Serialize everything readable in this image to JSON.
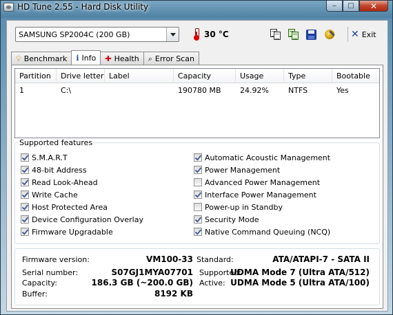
{
  "window": {
    "title": "HD Tune 2.55 - Hard Disk Utility",
    "minimize_glyph": "‒",
    "maximize_glyph": "□",
    "close_glyph": "✕"
  },
  "toolbar": {
    "drive": "SAMSUNG SP2004C (200 GB)",
    "temperature": "30 °C",
    "exit_label": "Exit",
    "icons": [
      "copy-text-icon",
      "copy-screenshot-icon",
      "save-icon",
      "options-icon",
      "exit-icon"
    ]
  },
  "tabs": [
    {
      "label": "Benchmark",
      "icon": "bulb-icon"
    },
    {
      "label": "Info",
      "icon": "info-icon",
      "active": true
    },
    {
      "label": "Health",
      "icon": "health-cross-icon"
    },
    {
      "label": "Error Scan",
      "icon": "magnifier-icon"
    }
  ],
  "partitions": {
    "columns": [
      "Partition",
      "Drive letter",
      "Label",
      "Capacity",
      "Usage",
      "Type",
      "Bootable"
    ],
    "rows": [
      [
        "1",
        "C:\\",
        "",
        "190780 MB",
        "24.92%",
        "NTFS",
        "Yes"
      ]
    ]
  },
  "features": {
    "legend": "Supported features",
    "left": [
      {
        "label": "S.M.A.R.T",
        "checked": true
      },
      {
        "label": "48-bit Address",
        "checked": true
      },
      {
        "label": "Read Look-Ahead",
        "checked": true
      },
      {
        "label": "Write Cache",
        "checked": true
      },
      {
        "label": "Host Protected Area",
        "checked": true
      },
      {
        "label": "Device Configuration Overlay",
        "checked": true
      },
      {
        "label": "Firmware Upgradable",
        "checked": true
      }
    ],
    "right": [
      {
        "label": "Automatic Acoustic Management",
        "checked": true
      },
      {
        "label": "Power Management",
        "checked": true
      },
      {
        "label": "Advanced Power Management",
        "checked": false
      },
      {
        "label": "Interface Power Management",
        "checked": true
      },
      {
        "label": "Power-up in Standby",
        "checked": false
      },
      {
        "label": "Security Mode",
        "checked": true
      },
      {
        "label": "Native Command Queuing (NCQ)",
        "checked": true
      }
    ]
  },
  "details": {
    "firmware_label": "Firmware version:",
    "firmware": "VM100-33",
    "serial_label": "Serial number:",
    "serial": "S07GJ1MYA07701",
    "capacity_label": "Capacity:",
    "capacity": "186.3 GB (~200.0 GB)",
    "buffer_label": "Buffer:",
    "buffer": "8192 KB",
    "standard_label": "Standard:",
    "standard": "ATA/ATAPI-7 - SATA II",
    "supported_label": "Supported:",
    "supported": "UDMA Mode 7 (Ultra ATA/512)",
    "active_label": "Active:",
    "active": "UDMA Mode 5 (Ultra ATA/100)"
  }
}
